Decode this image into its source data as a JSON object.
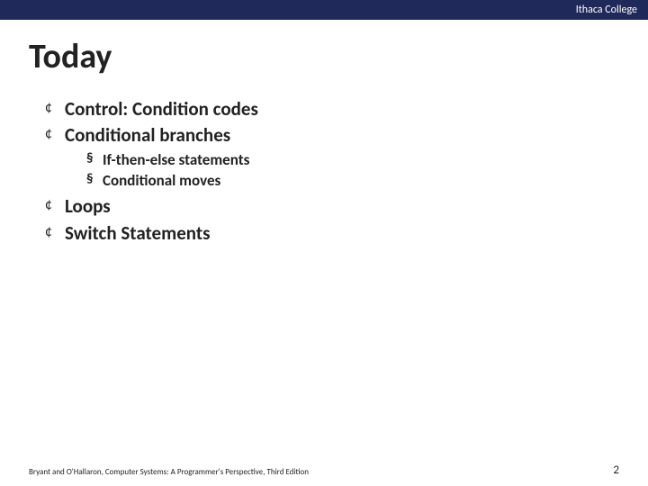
{
  "header": {
    "institution": "Ithaca College"
  },
  "title": "Today",
  "bullets": [
    {
      "text": "Control: Condition codes",
      "sub": []
    },
    {
      "text": "Conditional branches",
      "sub": [
        {
          "text": "If-then-else statements"
        },
        {
          "text": "Conditional moves"
        }
      ]
    },
    {
      "text": "Loops",
      "sub": []
    },
    {
      "text": "Switch Statements",
      "sub": []
    }
  ],
  "footer": {
    "left": "Bryant and O'Hallaron, Computer Systems: A Programmer's Perspective, Third Edition",
    "page": "2"
  }
}
